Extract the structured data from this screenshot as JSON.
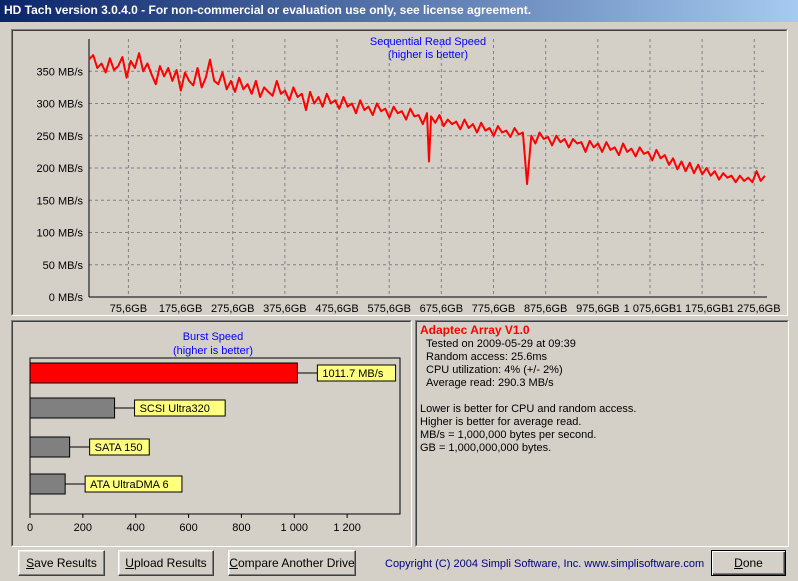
{
  "window": {
    "title": "HD Tach version 3.0.4.0  - For non-commercial or evaluation use only, see license agreement."
  },
  "read_chart": {
    "chart_data": {
      "type": "line",
      "title": "Sequential Read Speed",
      "subtitle": "(higher is better)",
      "y_unit": "MB/s",
      "ylim": [
        0,
        400
      ],
      "yticks": [
        "0 MB/s",
        "50 MB/s",
        "100 MB/s",
        "150 MB/s",
        "200 MB/s",
        "250 MB/s",
        "300 MB/s",
        "350 MB/s"
      ],
      "xticks": [
        "75,6GB",
        "175,6GB",
        "275,6GB",
        "375,6GB",
        "475,6GB",
        "575,6GB",
        "675,6GB",
        "775,6GB",
        "875,6GB",
        "975,6GB",
        "1 075,6GB",
        "1 175,6GB",
        "1 275,6GB"
      ],
      "x_range_gb": [
        0,
        1300
      ],
      "grid": true,
      "series": [
        {
          "color": "#ff0000",
          "points": [
            [
              0,
              368
            ],
            [
              8,
              375
            ],
            [
              16,
              355
            ],
            [
              24,
              362
            ],
            [
              32,
              348
            ],
            [
              40,
              370
            ],
            [
              48,
              352
            ],
            [
              56,
              358
            ],
            [
              64,
              372
            ],
            [
              72,
              340
            ],
            [
              80,
              366
            ],
            [
              88,
              355
            ],
            [
              96,
              378
            ],
            [
              104,
              350
            ],
            [
              112,
              362
            ],
            [
              120,
              345
            ],
            [
              128,
              330
            ],
            [
              136,
              358
            ],
            [
              144,
              342
            ],
            [
              152,
              355
            ],
            [
              160,
              335
            ],
            [
              168,
              352
            ],
            [
              176,
              320
            ],
            [
              184,
              348
            ],
            [
              192,
              335
            ],
            [
              200,
              328
            ],
            [
              208,
              355
            ],
            [
              216,
              325
            ],
            [
              224,
              340
            ],
            [
              232,
              368
            ],
            [
              240,
              335
            ],
            [
              248,
              330
            ],
            [
              256,
              348
            ],
            [
              264,
              322
            ],
            [
              272,
              335
            ],
            [
              280,
              318
            ],
            [
              288,
              340
            ],
            [
              296,
              322
            ],
            [
              304,
              330
            ],
            [
              312,
              315
            ],
            [
              320,
              335
            ],
            [
              328,
              310
            ],
            [
              336,
              325
            ],
            [
              344,
              318
            ],
            [
              352,
              312
            ],
            [
              360,
              335
            ],
            [
              368,
              315
            ],
            [
              376,
              320
            ],
            [
              384,
              305
            ],
            [
              392,
              325
            ],
            [
              400,
              310
            ],
            [
              408,
              315
            ],
            [
              416,
              290
            ],
            [
              424,
              318
            ],
            [
              432,
              300
            ],
            [
              440,
              310
            ],
            [
              448,
              295
            ],
            [
              456,
              315
            ],
            [
              464,
              300
            ],
            [
              472,
              305
            ],
            [
              480,
              292
            ],
            [
              488,
              310
            ],
            [
              496,
              295
            ],
            [
              504,
              300
            ],
            [
              512,
              285
            ],
            [
              520,
              305
            ],
            [
              528,
              290
            ],
            [
              536,
              295
            ],
            [
              544,
              282
            ],
            [
              552,
              300
            ],
            [
              560,
              288
            ],
            [
              568,
              292
            ],
            [
              576,
              278
            ],
            [
              584,
              295
            ],
            [
              592,
              285
            ],
            [
              600,
              288
            ],
            [
              608,
              275
            ],
            [
              616,
              292
            ],
            [
              624,
              280
            ],
            [
              632,
              282
            ],
            [
              640,
              268
            ],
            [
              648,
              285
            ],
            [
              652,
              210
            ],
            [
              656,
              280
            ],
            [
              664,
              270
            ],
            [
              672,
              282
            ],
            [
              680,
              265
            ],
            [
              688,
              275
            ],
            [
              696,
              268
            ],
            [
              704,
              272
            ],
            [
              712,
              260
            ],
            [
              720,
              275
            ],
            [
              728,
              262
            ],
            [
              736,
              268
            ],
            [
              744,
              255
            ],
            [
              752,
              270
            ],
            [
              760,
              258
            ],
            [
              768,
              262
            ],
            [
              776,
              250
            ],
            [
              784,
              265
            ],
            [
              792,
              255
            ],
            [
              800,
              258
            ],
            [
              808,
              248
            ],
            [
              816,
              262
            ],
            [
              824,
              252
            ],
            [
              832,
              255
            ],
            [
              840,
              175
            ],
            [
              848,
              250
            ],
            [
              856,
              238
            ],
            [
              864,
              255
            ],
            [
              872,
              245
            ],
            [
              880,
              248
            ],
            [
              888,
              235
            ],
            [
              896,
              250
            ],
            [
              904,
              240
            ],
            [
              912,
              245
            ],
            [
              920,
              232
            ],
            [
              928,
              245
            ],
            [
              936,
              238
            ],
            [
              944,
              240
            ],
            [
              952,
              225
            ],
            [
              960,
              242
            ],
            [
              968,
              232
            ],
            [
              976,
              238
            ],
            [
              984,
              225
            ],
            [
              992,
              240
            ],
            [
              1000,
              228
            ],
            [
              1008,
              232
            ],
            [
              1016,
              220
            ],
            [
              1024,
              238
            ],
            [
              1032,
              225
            ],
            [
              1040,
              230
            ],
            [
              1048,
              218
            ],
            [
              1056,
              232
            ],
            [
              1064,
              222
            ],
            [
              1072,
              225
            ],
            [
              1080,
              212
            ],
            [
              1088,
              228
            ],
            [
              1096,
              215
            ],
            [
              1104,
              220
            ],
            [
              1112,
              205
            ],
            [
              1120,
              215
            ],
            [
              1128,
              198
            ],
            [
              1136,
              210
            ],
            [
              1144,
              195
            ],
            [
              1152,
              208
            ],
            [
              1160,
              192
            ],
            [
              1168,
              205
            ],
            [
              1176,
              190
            ],
            [
              1184,
              200
            ],
            [
              1192,
              188
            ],
            [
              1200,
              195
            ],
            [
              1208,
              182
            ],
            [
              1216,
              192
            ],
            [
              1224,
              185
            ],
            [
              1232,
              188
            ],
            [
              1240,
              178
            ],
            [
              1248,
              188
            ],
            [
              1256,
              180
            ],
            [
              1264,
              185
            ],
            [
              1272,
              178
            ],
            [
              1280,
              195
            ],
            [
              1288,
              180
            ],
            [
              1296,
              188
            ]
          ]
        }
      ]
    }
  },
  "burst_chart": {
    "chart_data": {
      "type": "bar",
      "title": "Burst Speed",
      "subtitle": "(higher is better)",
      "orientation": "horizontal",
      "xlim": [
        0,
        1400
      ],
      "xticks": [
        "0",
        "200",
        "400",
        "600",
        "800",
        "1 000",
        "1 200"
      ],
      "categories": [
        "1011.7 MB/s",
        "SCSI Ultra320",
        "SATA 150",
        "ATA UltraDMA 6"
      ],
      "values": [
        1011.7,
        320,
        150,
        133
      ],
      "colors": [
        "#ff0000",
        "#808080",
        "#808080",
        "#808080"
      ],
      "label_bg": "#ffff80"
    }
  },
  "info": {
    "drive_name": "Adaptec Array V1.0",
    "lines": [
      "Tested on 2009-05-29 at 09:39",
      "Random access: 25.6ms",
      "CPU utilization: 4% (+/- 2%)",
      "Average read: 290.3 MB/s"
    ],
    "notes": [
      "Lower is better for CPU and random access.",
      "Higher is better for average read.",
      "MB/s = 1,000,000 bytes per second.",
      "GB = 1,000,000,000 bytes."
    ],
    "title_color": "#ff0000"
  },
  "buttons": {
    "save": {
      "prefix": "",
      "accel": "S",
      "rest": "ave Results"
    },
    "upload": {
      "prefix": "",
      "accel": "U",
      "rest": "pload Results"
    },
    "compare": {
      "prefix": "",
      "accel": "C",
      "rest": "ompare Another Drive"
    },
    "done": {
      "prefix": "",
      "accel": "D",
      "rest": "one"
    }
  },
  "footer": {
    "copyright": "Copyright (C) 2004 Simpli Software, Inc. www.simplisoftware.com"
  }
}
